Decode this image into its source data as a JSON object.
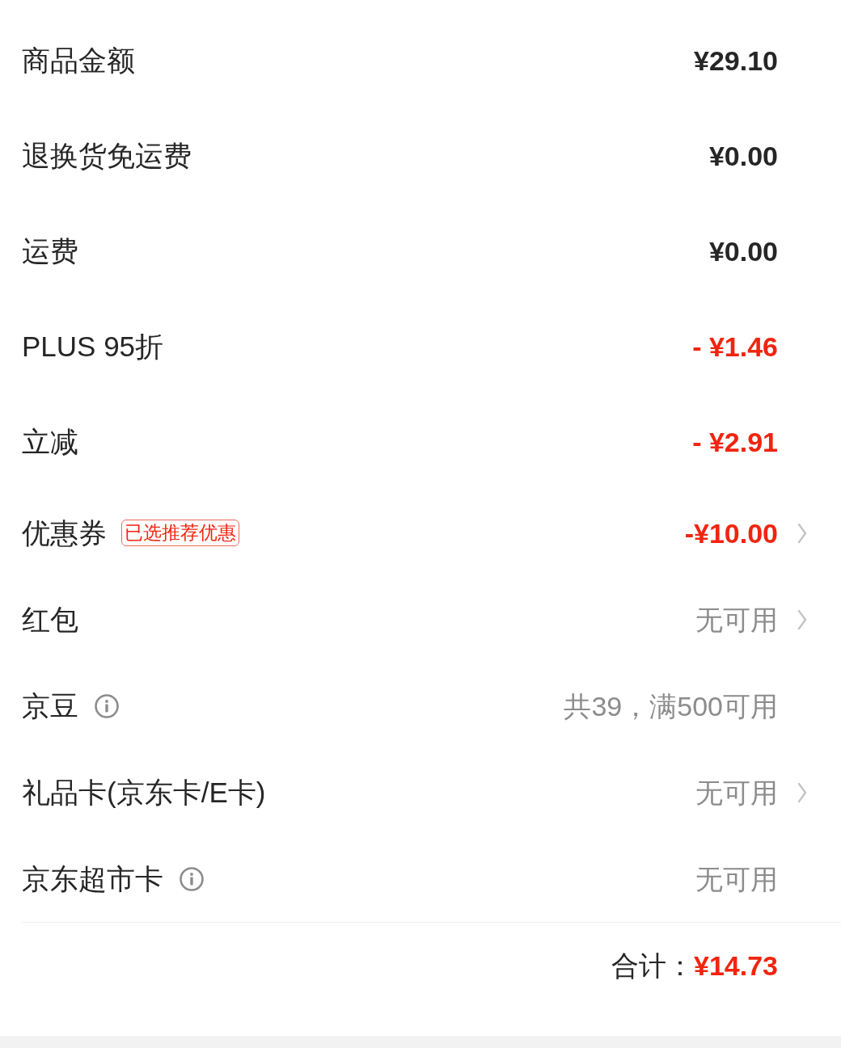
{
  "rows": [
    {
      "kind": "price",
      "label": "商品金额",
      "value": "¥29.10",
      "info": false,
      "chevron": false
    },
    {
      "kind": "price",
      "label": "退换货免运费",
      "value": "¥0.00",
      "info": false,
      "chevron": false
    },
    {
      "kind": "price",
      "label": "运费",
      "value": "¥0.00",
      "info": false,
      "chevron": false
    },
    {
      "kind": "discount",
      "label": "PLUS 95折",
      "value": "- ¥1.46",
      "info": false,
      "chevron": false
    },
    {
      "kind": "discount",
      "label": "立减",
      "value": "- ¥2.91",
      "info": false,
      "chevron": false
    },
    {
      "kind": "discount",
      "label": "优惠券",
      "badge": "已选推荐优惠",
      "value": "-¥10.00",
      "info": false,
      "chevron": true
    },
    {
      "kind": "note",
      "label": "红包",
      "value": "无可用",
      "info": false,
      "chevron": true
    },
    {
      "kind": "note",
      "label": "京豆",
      "value": "共39，满500可用",
      "info": true,
      "chevron": false
    },
    {
      "kind": "note",
      "label": "礼品卡(京东卡/E卡)",
      "value": "无可用",
      "info": false,
      "chevron": true
    },
    {
      "kind": "note",
      "label": "京东超市卡",
      "value": "无可用",
      "info": true,
      "chevron": false
    }
  ],
  "total": {
    "label": "合计：",
    "value": "¥14.73"
  }
}
